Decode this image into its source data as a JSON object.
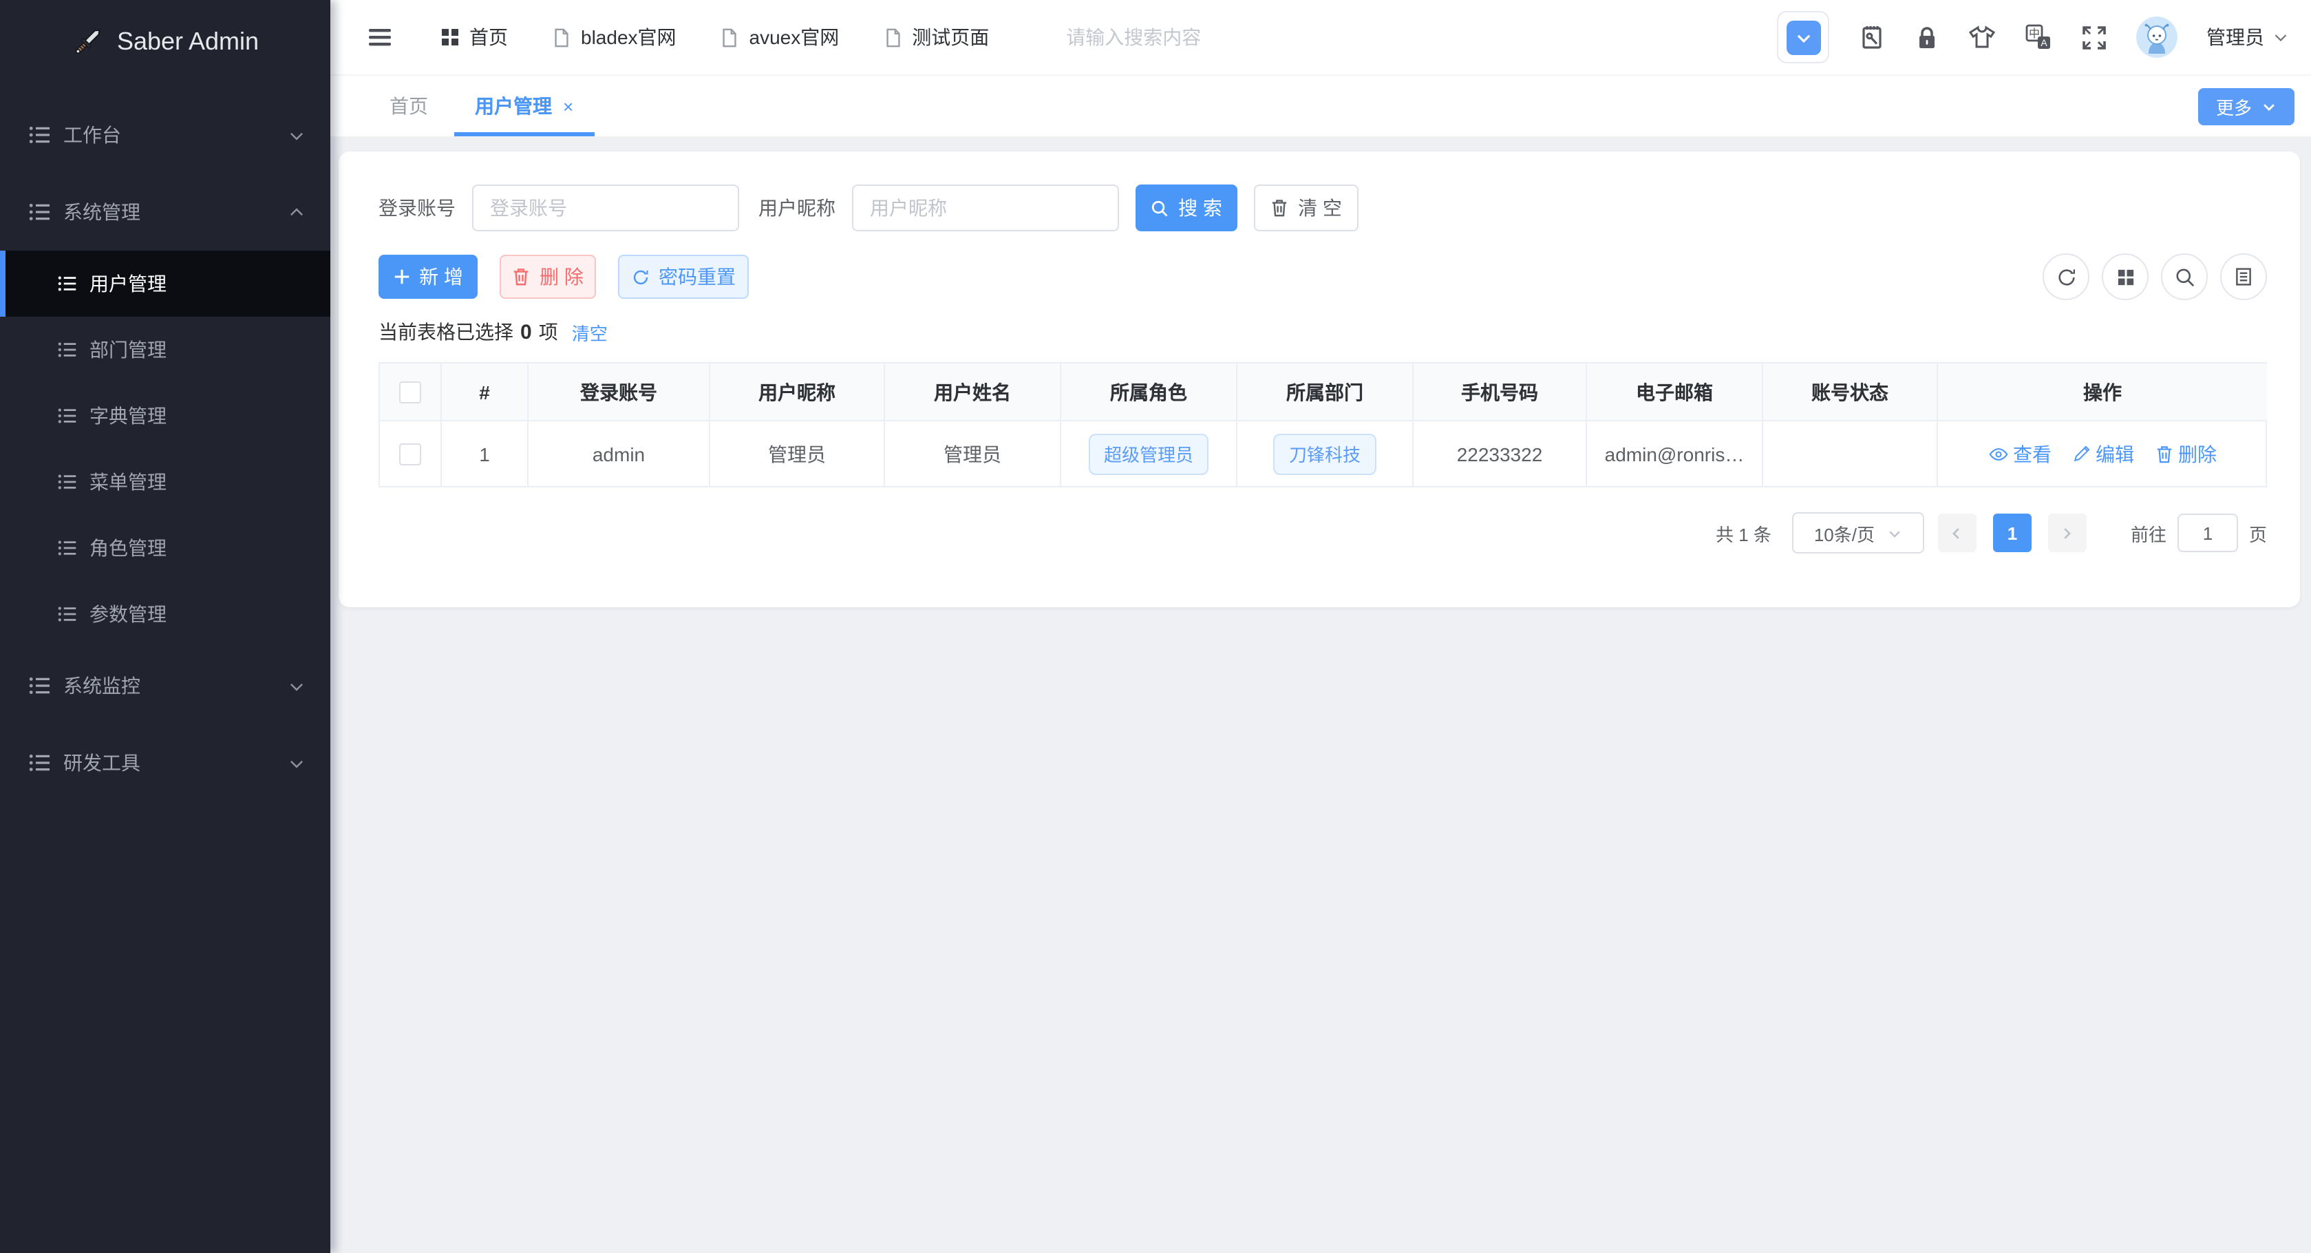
{
  "app": {
    "title": "Saber Admin"
  },
  "colors": {
    "primary": "#4a97f8",
    "danger": "#f56c6c",
    "sidebar_bg": "#21242e",
    "sidebar_active_bg": "#0b0d12",
    "page_bg": "#eef0f4",
    "tag_bg": "#eef6ff"
  },
  "sidebar": {
    "items": [
      {
        "label": "工作台",
        "level": "group",
        "chevron": "down"
      },
      {
        "label": "系统管理",
        "level": "group",
        "chevron": "up",
        "expanded": true
      },
      {
        "label": "用户管理",
        "level": "sub",
        "active": true
      },
      {
        "label": "部门管理",
        "level": "sub"
      },
      {
        "label": "字典管理",
        "level": "sub"
      },
      {
        "label": "菜单管理",
        "level": "sub"
      },
      {
        "label": "角色管理",
        "level": "sub"
      },
      {
        "label": "参数管理",
        "level": "sub"
      },
      {
        "label": "系统监控",
        "level": "group",
        "chevron": "down"
      },
      {
        "label": "研发工具",
        "level": "group",
        "chevron": "down"
      }
    ]
  },
  "topbar": {
    "nav": [
      {
        "label": "首页",
        "icon": "grid-icon"
      },
      {
        "label": "bladex官网",
        "icon": "document-icon"
      },
      {
        "label": "avuex官网",
        "icon": "document-icon"
      },
      {
        "label": "测试页面",
        "icon": "document-icon"
      }
    ],
    "search_placeholder": "请输入搜索内容",
    "search_value": "",
    "user_name": "管理员"
  },
  "tabs": {
    "items": [
      {
        "label": "首页",
        "active": false
      },
      {
        "label": "用户管理",
        "active": true,
        "closable": true
      }
    ],
    "more_label": "更多"
  },
  "filters": {
    "account": {
      "label": "登录账号",
      "placeholder": "登录账号",
      "value": ""
    },
    "nickname": {
      "label": "用户昵称",
      "placeholder": "用户昵称",
      "value": ""
    },
    "search_label": "搜 索",
    "clear_label": "清 空"
  },
  "actions": {
    "add_label": "新 增",
    "delete_label": "删 除",
    "reset_password_label": "密码重置"
  },
  "selection": {
    "prefix": "当前表格已选择",
    "count": "0",
    "suffix": "项",
    "clear_label": "清空"
  },
  "table": {
    "headers": [
      "#",
      "登录账号",
      "用户昵称",
      "用户姓名",
      "所属角色",
      "所属部门",
      "手机号码",
      "电子邮箱",
      "账号状态",
      "操作"
    ],
    "rows": [
      {
        "index": "1",
        "account": "admin",
        "nickname": "管理员",
        "name": "管理员",
        "role": "超级管理员",
        "dept": "刀锋科技",
        "phone": "22233322",
        "email": "admin@ronris…",
        "status": "",
        "ops": [
          "查看",
          "编辑",
          "删除"
        ]
      }
    ]
  },
  "pagination": {
    "total": "共 1 条",
    "page_size": "10条/页",
    "current_page": "1",
    "goto_label": "前往",
    "goto_value": "1",
    "page_unit": "页"
  }
}
